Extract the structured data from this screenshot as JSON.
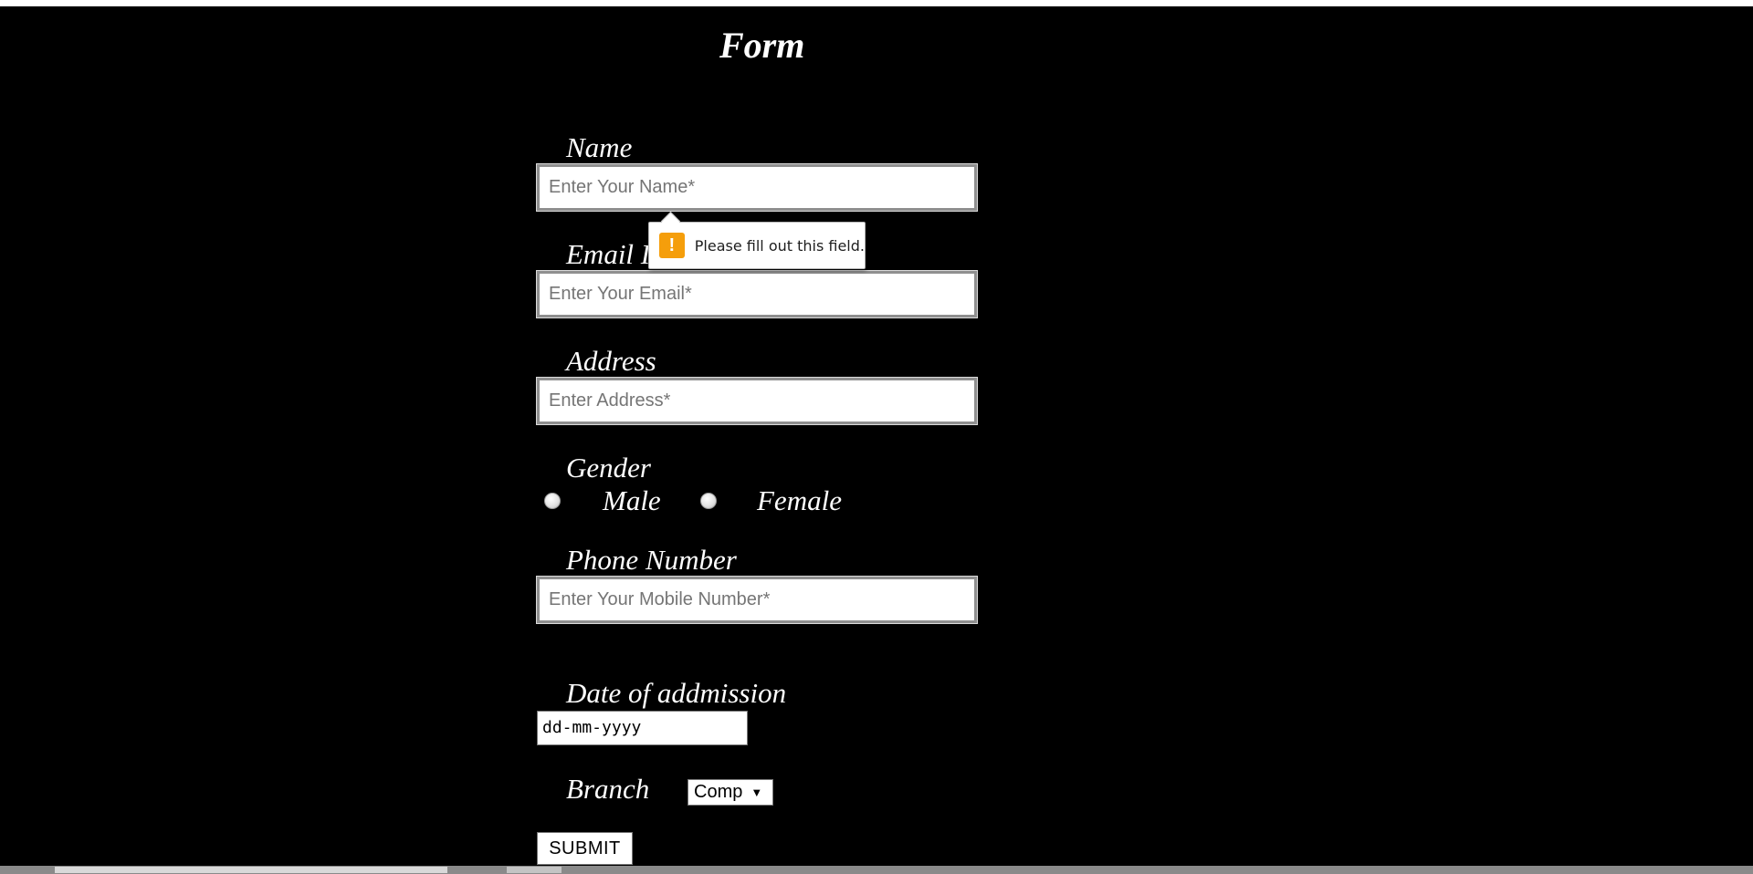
{
  "form": {
    "title": "Form",
    "name": {
      "label": "Name",
      "placeholder": "Enter Your Name*"
    },
    "email": {
      "label": "Email I",
      "placeholder": "Enter Your Email*"
    },
    "address": {
      "label": "Address",
      "placeholder": "Enter Address*"
    },
    "gender": {
      "label": "Gender",
      "options": [
        {
          "label": "Male",
          "selected": false
        },
        {
          "label": "Female",
          "selected": false
        }
      ]
    },
    "phone": {
      "label": "Phone Number",
      "placeholder": "Enter Your Mobile Number*"
    },
    "date": {
      "label": "Date of addmission",
      "value": "dd-mm-yyyy"
    },
    "branch": {
      "label": "Branch",
      "selected": "Comp",
      "arrow": "▼"
    },
    "submit_label": "SUBMIT"
  },
  "validation_tooltip": {
    "icon": "warning-icon",
    "icon_glyph": "!",
    "message": "Please fill out this field.",
    "accent_color": "#f59e0b"
  }
}
